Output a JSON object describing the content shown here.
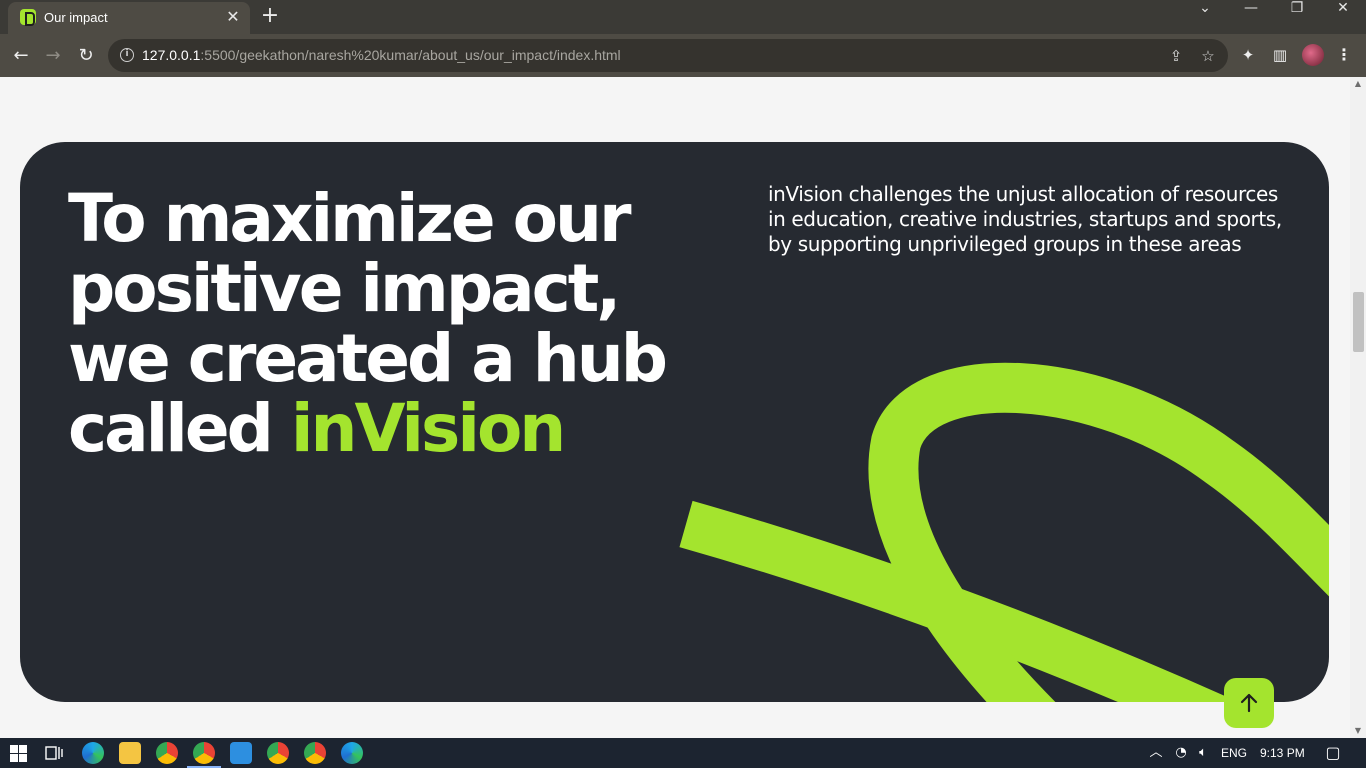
{
  "browser": {
    "tab_title": "Our impact",
    "tab_close": "✕",
    "new_tab": "+",
    "url_host": "127.0.0.1",
    "url_rest": ":5500/geekathon/naresh%20kumar/about_us/our_impact/index.html",
    "window_controls": {
      "minimize": "—",
      "restore": "❐",
      "close": "✕",
      "tab_search": "⌄"
    },
    "nav": {
      "back": "←",
      "forward": "→",
      "reload": "↻"
    },
    "icons": {
      "share": "⇪",
      "star": "☆",
      "extensions": "✦",
      "sidepanel": "▥",
      "menu": "⋮",
      "info": "i"
    }
  },
  "page": {
    "hero": {
      "title_line1": "To maximize our",
      "title_line2": "positive impact,",
      "title_line3": "we created a hub",
      "title_line4_prefix": "called ",
      "title_accent": "inVision",
      "description": "inVision challenges the unjust allocation of resources in education, creative industries, startups and sports, by supporting unprivileged groups in these areas"
    },
    "back_to_top_icon": "arrow-up-icon",
    "colors": {
      "accent": "#a4e42e",
      "panel": "#262a31",
      "page_bg": "#f5f5f5"
    }
  },
  "taskbar": {
    "language": "ENG",
    "time": "9:13 PM",
    "tray_chevron": "︿",
    "wifi": "◔",
    "volume": "🔈︎",
    "notification": "▢"
  }
}
